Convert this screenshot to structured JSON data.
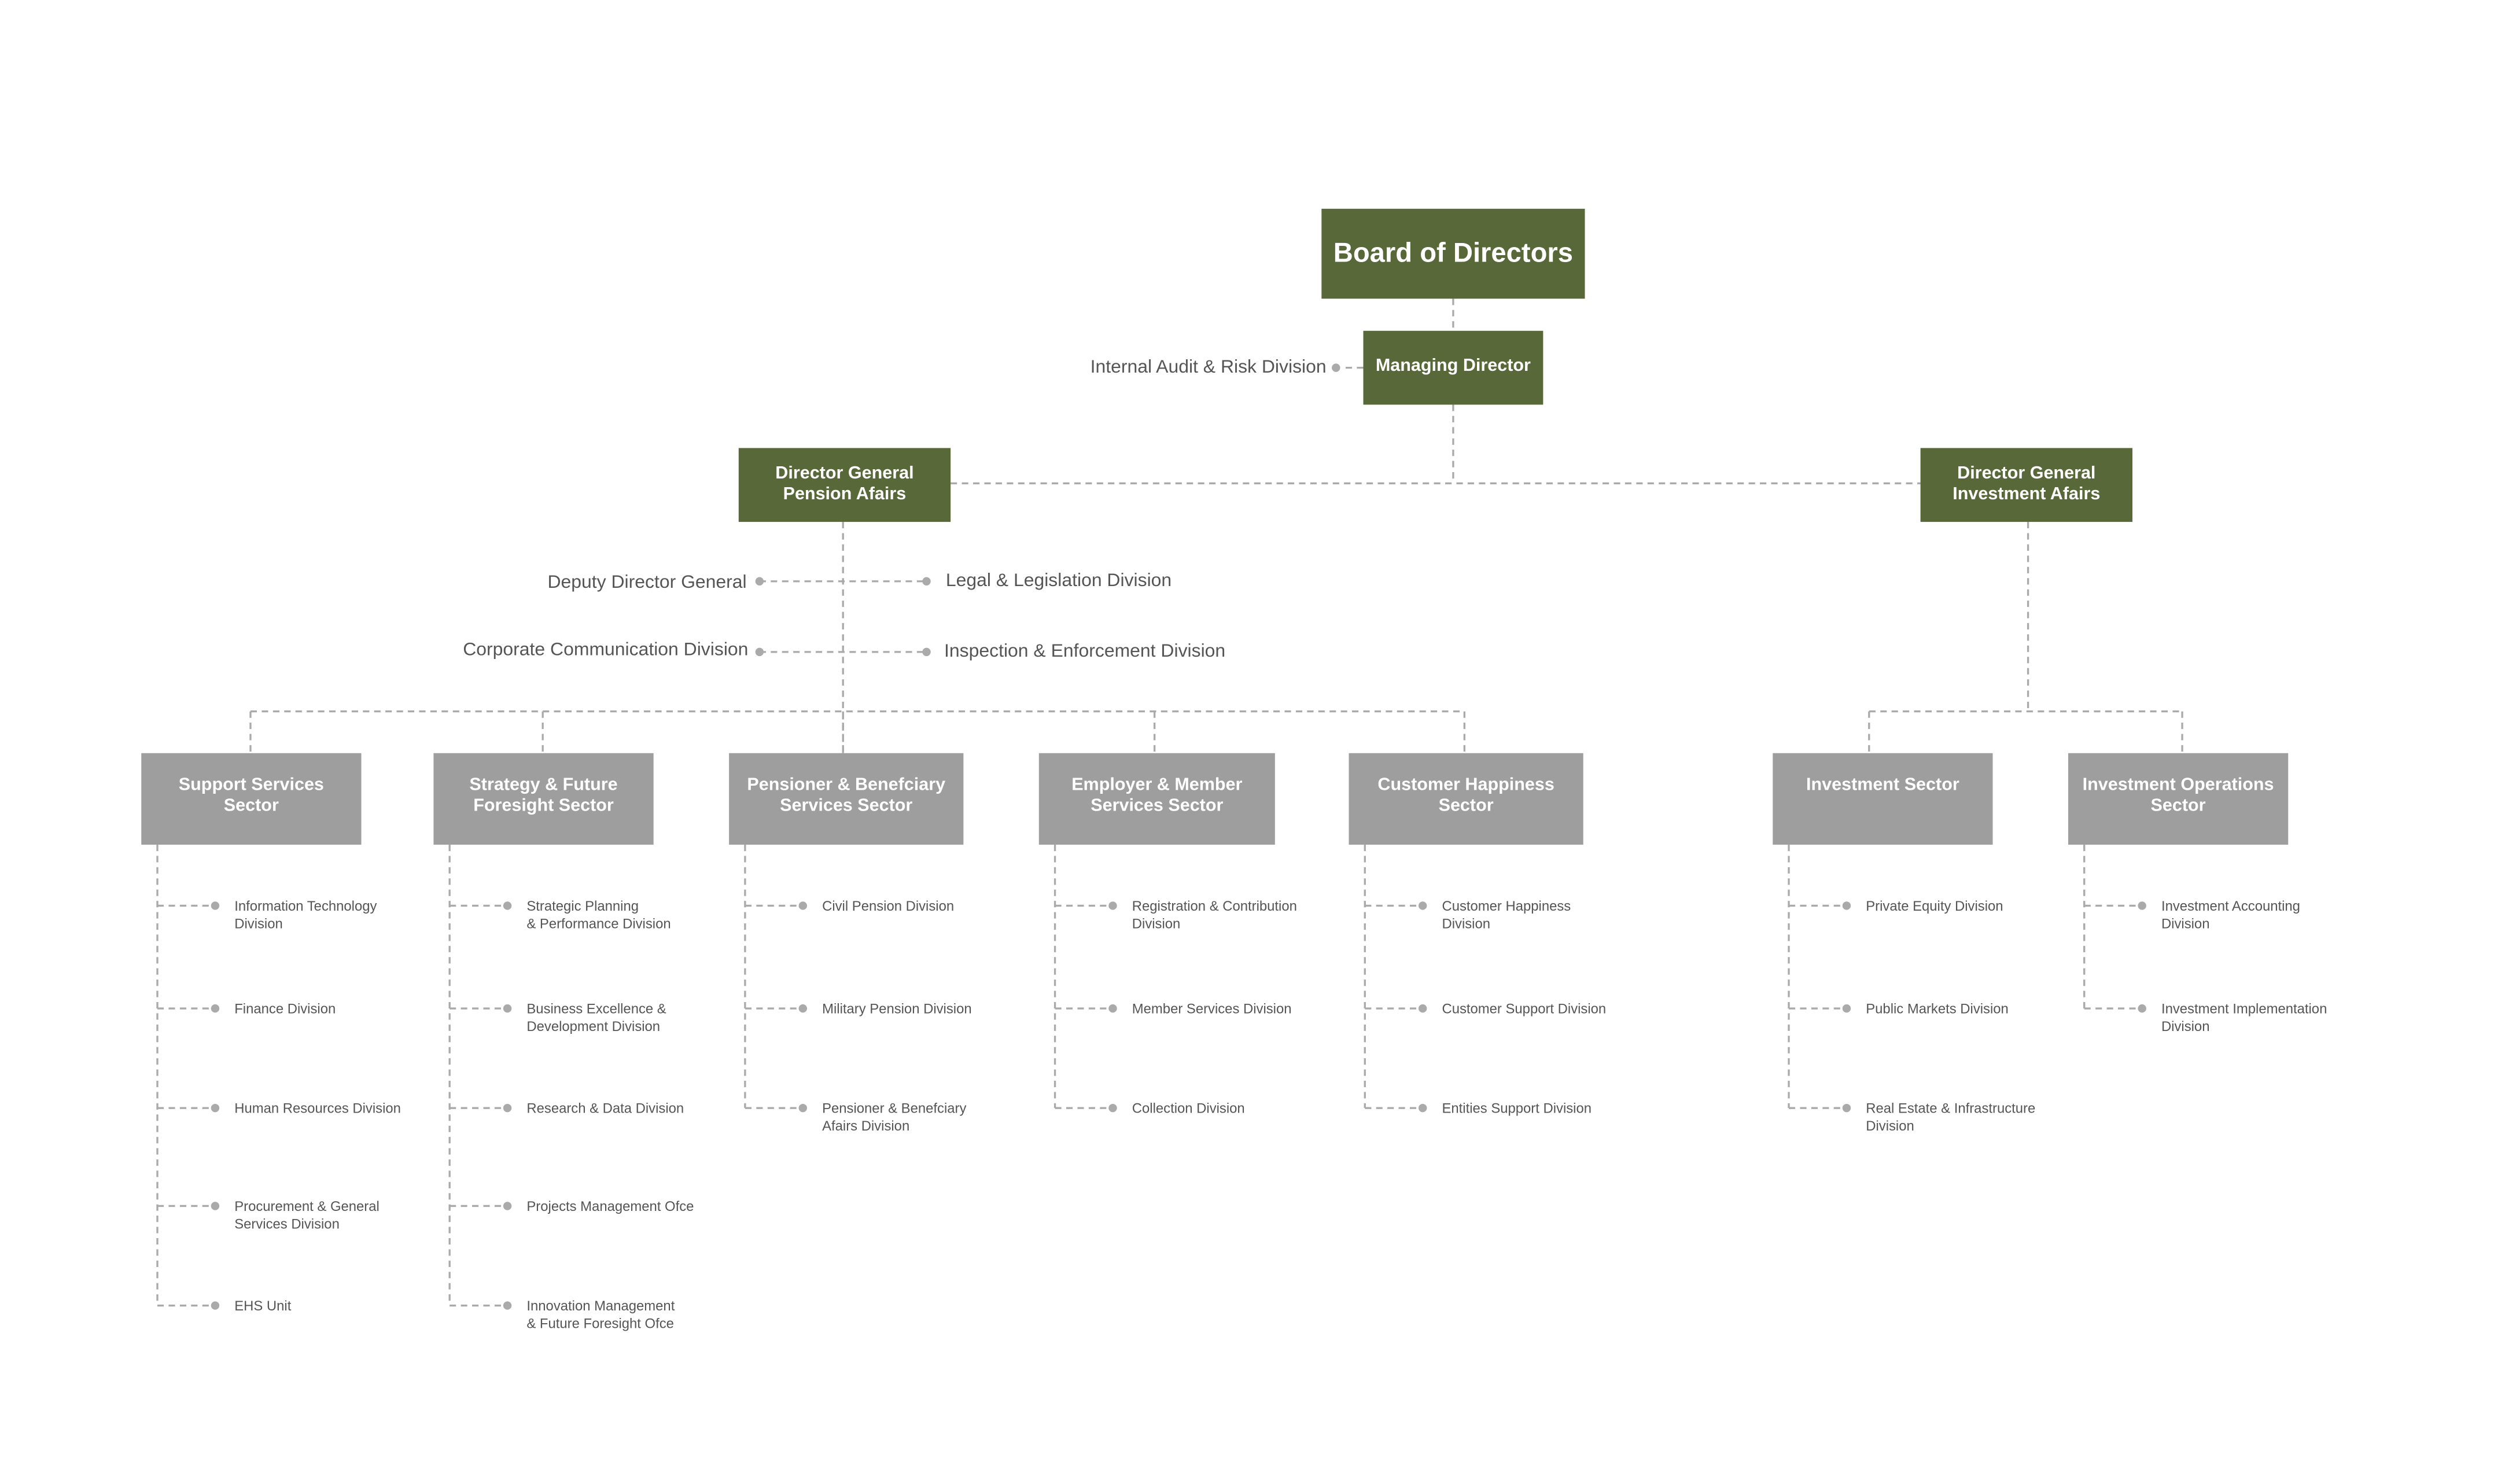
{
  "colors": {
    "leadership": "#586838",
    "sector": "#9e9e9e",
    "connector": "#aaaaaa",
    "text": "#555555"
  },
  "board": "Board of Directors",
  "managing_director": "Managing Director",
  "internal_audit": "Internal Audit & Risk Division",
  "dg_pension": "Director General\nPension Afairs",
  "dg_investment": "Director General\nInvestment Afairs",
  "pension_staff": {
    "deputy": "Deputy Director General",
    "legal": "Legal & Legislation Division",
    "corporate": "Corporate Communication Division",
    "inspection": "Inspection & Enforcement Division"
  },
  "sectors": [
    {
      "name": "Support Services\nSector",
      "children": [
        "Information Technology\nDivision",
        "Finance Division",
        "Human Resources Division",
        "Procurement & General\nServices Division",
        "EHS Unit"
      ]
    },
    {
      "name": "Strategy & Future\nForesight Sector",
      "children": [
        "Strategic Planning\n& Performance Division",
        "Business Excellence &\nDevelopment Division",
        "Research & Data Division",
        "Projects Management Ofce",
        "Innovation Management\n& Future Foresight Ofce"
      ]
    },
    {
      "name": "Pensioner & Benefciary\nServices Sector",
      "children": [
        "Civil Pension Division",
        "Military Pension Division",
        "Pensioner & Benefciary\nAfairs Division"
      ]
    },
    {
      "name": "Employer & Member\nServices Sector",
      "children": [
        "Registration & Contribution\nDivision",
        "Member Services Division",
        "Collection Division"
      ]
    },
    {
      "name": "Customer Happiness\nSector",
      "children": [
        "Customer Happiness\nDivision",
        "Customer Support Division",
        "Entities Support Division"
      ]
    },
    {
      "name": "Investment Sector",
      "children": [
        "Private Equity Division",
        "Public Markets Division",
        "Real Estate & Infrastructure\nDivision"
      ]
    },
    {
      "name": "Investment Operations\nSector",
      "children": [
        "Investment Accounting\nDivision",
        "Investment Implementation\nDivision"
      ]
    }
  ]
}
